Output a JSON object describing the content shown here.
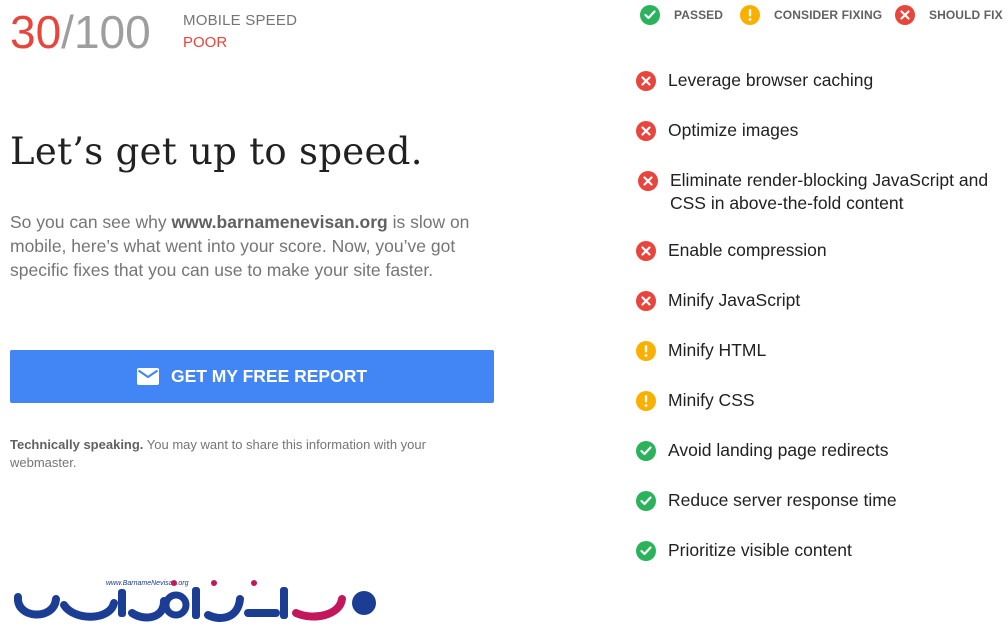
{
  "score": {
    "value": "30",
    "separator": "/",
    "max": "100",
    "label": "MOBILE SPEED",
    "rating": "POOR"
  },
  "headline": "Let’s get up to speed.",
  "description": {
    "pre": "So you can see why ",
    "site": "www.barnamenevisan.org",
    "post": " is slow on mobile, here’s what went into your score. Now, you’ve got specific fixes that you can use to make your site faster."
  },
  "report_button": {
    "label": "GET MY FREE REPORT",
    "icon": "mail-icon"
  },
  "technical_note": {
    "bold": "Technically speaking.",
    "rest": " You may want to share this information with your webmaster."
  },
  "legend": {
    "passed": "PASSED",
    "consider": "CONSIDER FIXING",
    "should_fix": "SHOULD FIX"
  },
  "rules": [
    {
      "status": "fail",
      "text": "Leverage browser caching"
    },
    {
      "status": "fail",
      "text": "Optimize images"
    },
    {
      "status": "fail",
      "text": "Eliminate render-blocking JavaScript and CSS in above-the-fold content"
    },
    {
      "status": "fail",
      "text": "Enable compression"
    },
    {
      "status": "fail",
      "text": "Minify JavaScript"
    },
    {
      "status": "warn",
      "text": "Minify HTML"
    },
    {
      "status": "warn",
      "text": "Minify CSS"
    },
    {
      "status": "pass",
      "text": "Avoid landing page redirects"
    },
    {
      "status": "pass",
      "text": "Reduce server response time"
    },
    {
      "status": "pass",
      "text": "Prioritize visible content"
    }
  ],
  "logo": {
    "tagline": "www.BarnameNevisan.org",
    "wordmark": "برنامه نویسان"
  },
  "colors": {
    "fail": "#e8453c",
    "warn": "#f9b000",
    "pass": "#2bb35c",
    "accent": "#4285f4"
  }
}
